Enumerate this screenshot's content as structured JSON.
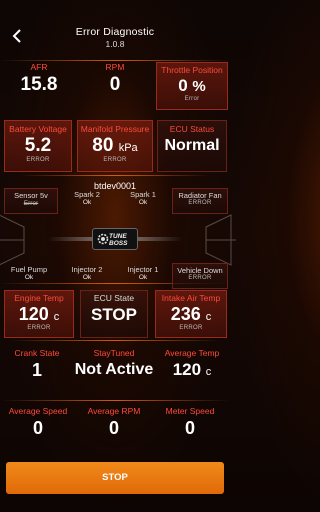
{
  "header": {
    "title": "Error Diagnostic",
    "version": "1.0.8"
  },
  "row1": [
    {
      "label": "AFR",
      "value": "15.8",
      "unit": "",
      "error": ""
    },
    {
      "label": "RPM",
      "value": "0",
      "unit": "",
      "error": ""
    },
    {
      "label": "Throttle Position",
      "value": "0",
      "unit": "%",
      "error": "Error"
    }
  ],
  "row2": [
    {
      "label": "Battery Voltage",
      "value": "5.2",
      "unit": "",
      "error": "ERROR"
    },
    {
      "label": "Manifold Pressure",
      "value": "80",
      "unit": "kPa",
      "error": "ERROR"
    },
    {
      "label": "ECU Status",
      "value": "Normal",
      "unit": "",
      "error": ""
    }
  ],
  "sensors_top": [
    {
      "label": "Sensor 5v",
      "value": "Error"
    },
    {
      "label": "Spark 2",
      "value": "Ok"
    },
    {
      "label": "Spark 1",
      "value": "Ok"
    },
    {
      "label": "Radiator Fan",
      "value": "ERROR"
    }
  ],
  "device_name": "btdev0001",
  "logo": {
    "line1": "TUNE",
    "line2": "BOSS"
  },
  "sensors_bottom": [
    {
      "label": "Fuel Pump",
      "value": "Ok"
    },
    {
      "label": "Injector 2",
      "value": "Ok"
    },
    {
      "label": "Injector 1",
      "value": "Ok"
    },
    {
      "label": "Vehicle Down",
      "value": "ERROR"
    }
  ],
  "row3": [
    {
      "label": "Engine Temp",
      "value": "120",
      "unit": "c",
      "error": "ERROR"
    },
    {
      "label": "ECU State",
      "value": "STOP",
      "unit": "",
      "error": ""
    },
    {
      "label": "Intake Air Temp",
      "value": "236",
      "unit": "c",
      "error": "ERROR"
    }
  ],
  "row4": [
    {
      "label": "Crank State",
      "value": "1",
      "unit": ""
    },
    {
      "label": "StayTuned",
      "value": "Not Active",
      "unit": ""
    },
    {
      "label": "Average Temp",
      "value": "120",
      "unit": "c"
    }
  ],
  "row5": [
    {
      "label": "Average Speed",
      "value": "0"
    },
    {
      "label": "Average RPM",
      "value": "0"
    },
    {
      "label": "Meter Speed",
      "value": "0"
    }
  ],
  "stop_button": "STOP",
  "colors": {
    "accent": "#ff4a3a",
    "button": "#e8780f",
    "box": "#9a2a1c"
  }
}
